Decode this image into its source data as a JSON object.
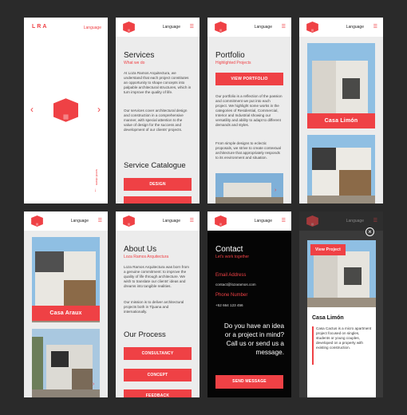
{
  "common": {
    "language": "Language",
    "brand": "LRA"
  },
  "s1": {
    "scroll_hint": "scroll down"
  },
  "s2": {
    "title": "Services",
    "subtitle": "What we do",
    "p1": "At Loza Ramos Arquitectura, we understand that each project constitutes an opportunity to shape concepts into palpable architectural structures, which in turn improve the quality of life.",
    "p2": "Our services cover architectural design and construction in a comprehensive manner, with special attention to the value of design for the success and development of our clients' projects.",
    "catalogue": "Service Catalogue",
    "design_btn": "DESIGN"
  },
  "s3": {
    "title": "Portfolio",
    "subtitle": "Highlighted Projects",
    "view_btn": "VIEW PORTFOLIO",
    "p1": "Our portfolio is a reflection of the passion and commitment we put into each project. We highlight some works in the categories of Residential, Commercial, Interior and Industrial showing our versatility and ability to adapt to different demands and styles.",
    "p2": "From simple designs to eclectic proposals, we strive to create contextual architecture that appropriately responds to its environment and situation."
  },
  "s4": {
    "label": "Casa Limón"
  },
  "s5": {
    "label": "Casa Araux"
  },
  "s6": {
    "title": "About Us",
    "subtitle": "Loza Ramos Arquitectura",
    "p1": "Loza Ramos Arquitectura was born from a genuine commitment: to improve the quality of life through architecture. We wish to translate our clients' ideas and dreams into tangible realities.",
    "p2": "Our mission is to deliver architectural projects both in Tijuana and internationally.",
    "process": "Our Process",
    "b1": "CONSULTANCY",
    "b2": "CONCEPT",
    "b3": "FEEDBACK"
  },
  "s7": {
    "title": "Contact",
    "subtitle": "Let's work together",
    "email_label": "Email Address",
    "email": "contact@lozaramos.com",
    "phone_label": "Phone Number",
    "phone": "+52 664 123 456",
    "cta": "Do you have an idea or a project in mind? Call us or send us a message.",
    "send_btn": "SEND MESSAGE"
  },
  "s8": {
    "view_btn": "View Project",
    "title": "Casa Limón",
    "desc": "Casa Cactus is a micro apartment project focused on singles, students or young couples, developed on a property with existing construction."
  },
  "colors": {
    "accent": "#ef4145",
    "bg": "#2a2a2a"
  }
}
